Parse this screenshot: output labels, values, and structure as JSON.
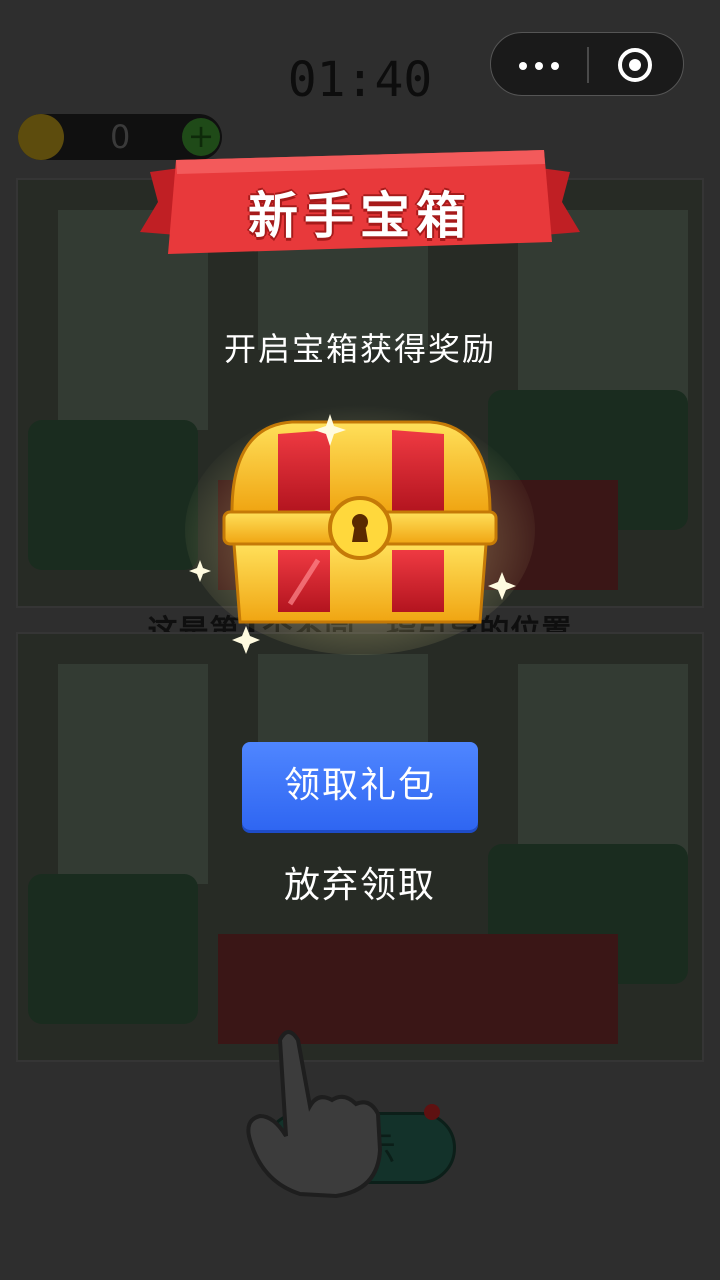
{
  "game": {
    "timer": "01:40",
    "coins": "0",
    "coin_plus": "+",
    "level_tag": "",
    "hint_text": "这是第1个不同，指引导的位置",
    "hint_button": "提示"
  },
  "modal": {
    "banner_title": "新手宝箱",
    "subtitle": "开启宝箱获得奖励",
    "claim_button": "领取礼包",
    "give_up": "放弃领取"
  },
  "colors": {
    "banner_red": "#e8393b",
    "chest_gold": "#f7c01e",
    "chest_red": "#d8202c",
    "claim_blue": "#3b74f8"
  },
  "icons": {
    "capsule_more": "more-dots-icon",
    "capsule_close": "target-close-icon",
    "pointer": "pointing-hand-icon"
  }
}
